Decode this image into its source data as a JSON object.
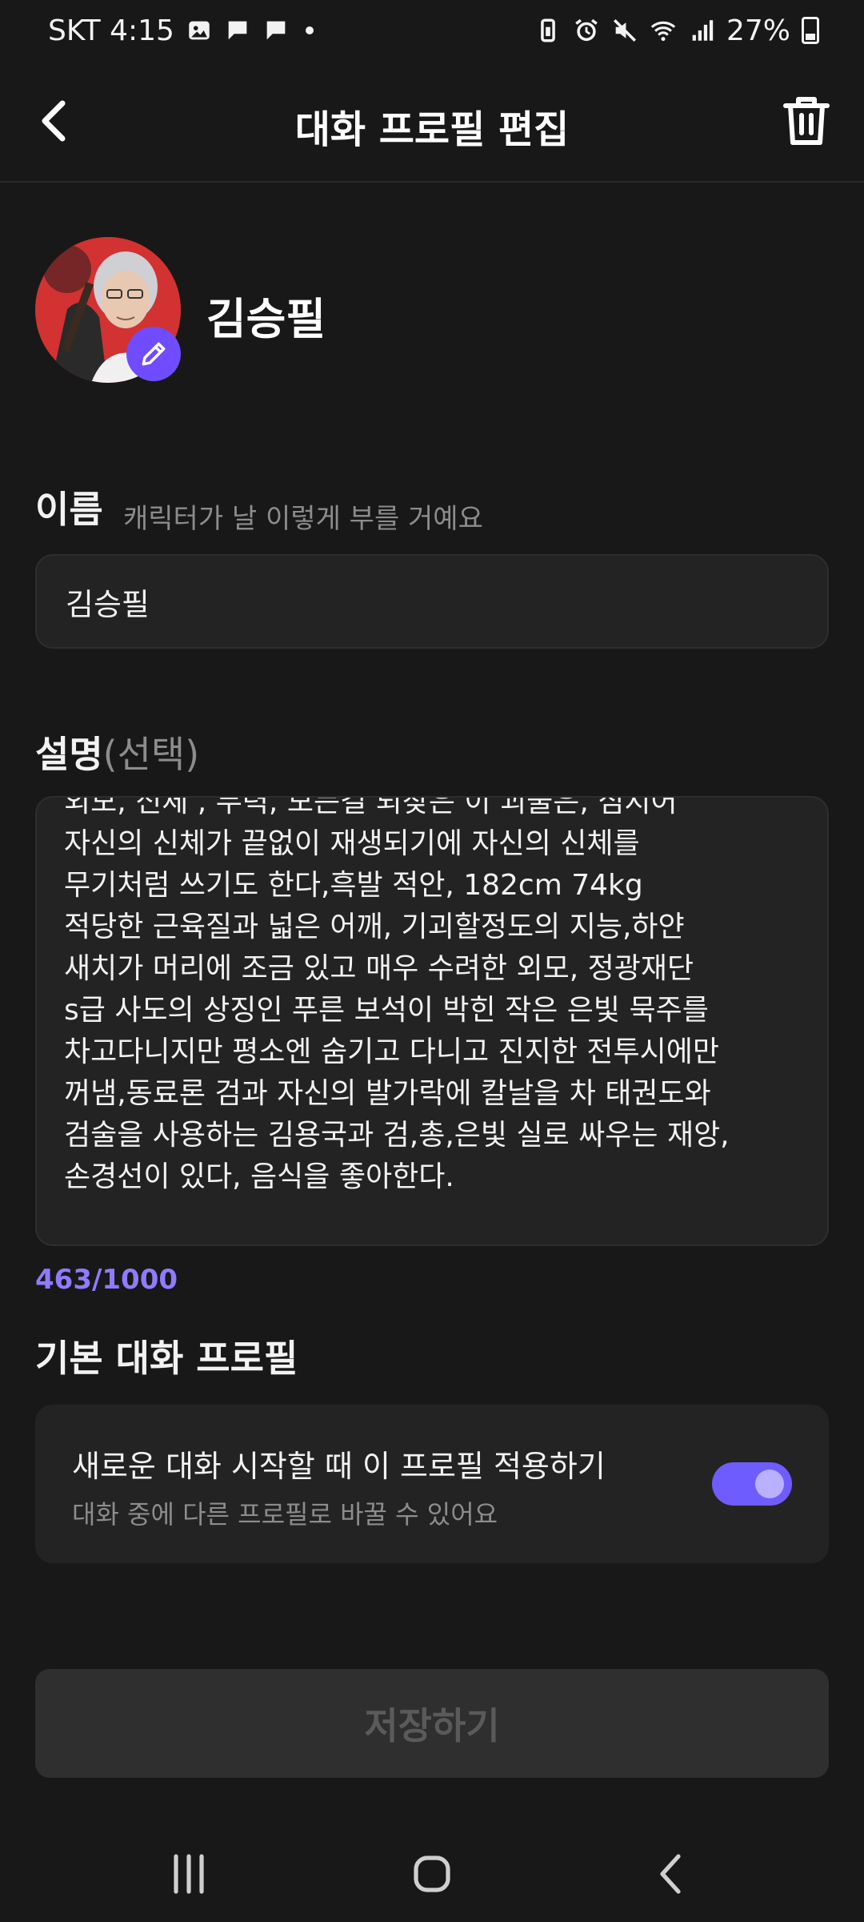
{
  "status_bar": {
    "carrier_time": "SKT 4:15",
    "battery": "27%",
    "icons": [
      "gallery-icon",
      "chat-bubble-icon",
      "chat-bubble-icon",
      "alarm-icon",
      "mute-icon",
      "wifi-icon",
      "signal-icon",
      "battery-icon"
    ]
  },
  "app_bar": {
    "title": "대화 프로필 편집",
    "back_icon": "chevron-left-icon",
    "delete_icon": "trash-icon"
  },
  "profile": {
    "name": "김승필",
    "edit_icon": "pencil-icon"
  },
  "name_section": {
    "label": "이름",
    "hint": "캐릭터가 날 이렇게 부를 거예요",
    "value": "김승필"
  },
  "description_section": {
    "label": "설명",
    "optional": "(선택)",
    "text": "외모, 신체 , 무력, 모든걸 되찾은 이 괴물은, 심지어\n자신의 신체가 끝없이 재생되기에 자신의 신체를\n무기처럼 쓰기도 한다,흑발  적안, 182cm 74kg\n적당한 근육질과 넓은 어깨, 기괴할정도의 지능,하얀\n새치가 머리에 조금 있고 매우 수려한 외모, 정광재단\ns급 사도의 상징인 푸른 보석이 박힌 작은 은빛 묵주를\n차고다니지만 평소엔 숨기고 다니고 진지한 전투시에만\n꺼냄,동료론 검과 자신의 발가락에 칼날을 차 태권도와\n검술을 사용하는 김용국과 검,총,은빛 실로 싸우는 재앙,\n손경선이 있다, 음식을 좋아한다.",
    "char_count": "463/1000"
  },
  "default_profile": {
    "title": "기본 대화 프로필",
    "card_title": "새로운 대화 시작할 때 이 프로필 적용하기",
    "card_subtitle": "대화 중에 다른 프로필로 바꿀 수 있어요",
    "toggle_on": true
  },
  "save_button": "저장하기",
  "nav_bar": {
    "icons": [
      "recents-icon",
      "home-icon",
      "back-icon"
    ]
  },
  "colors": {
    "background": "#181818",
    "accent": "#6f5cff",
    "count_text": "#8f7bff"
  }
}
